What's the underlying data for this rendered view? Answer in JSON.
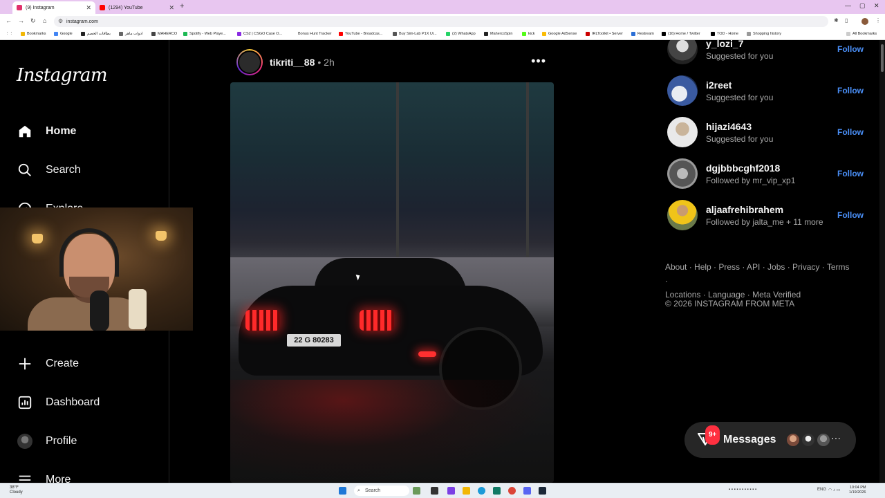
{
  "browser": {
    "tabs": [
      {
        "label": "(9) Instagram",
        "active": true,
        "favicon_color": "#e1306c"
      },
      {
        "label": "(1294) YouTube",
        "active": false,
        "favicon_color": "#ff0000"
      }
    ],
    "url": "instagram.com",
    "bookmarks": [
      "Bookmarks",
      "Google",
      "بطاقات الخصم",
      "ادوات ماهر",
      "MAHERCO",
      "Spotify - Web Playe...",
      "CS2 | CSGO Case O...",
      "Bonus Hunt Tracker",
      "YouTube - Broadcas...",
      "Buy Sim-Lab P1X Ui...",
      "(2) WhatsApp",
      "MahercoSpin",
      "kick",
      "Google AdSense",
      "IRLToolkit • Server",
      "Restream",
      "(16) Home / Twitter",
      "TOD - Home",
      "Shopping history",
      "All Bookmarks"
    ]
  },
  "sidebar": {
    "logo": "Instagram",
    "items": [
      {
        "label": "Home",
        "icon": "home-icon",
        "bold": true
      },
      {
        "label": "Search",
        "icon": "search-icon"
      },
      {
        "label": "Explore",
        "icon": "explore-icon"
      },
      {
        "label": "Create",
        "icon": "plus-icon"
      },
      {
        "label": "Dashboard",
        "icon": "dashboard-icon"
      },
      {
        "label": "Profile",
        "icon": "avatar"
      },
      {
        "label": "More",
        "icon": "menu-icon"
      }
    ]
  },
  "post": {
    "username": "tikriti__88",
    "time": "• 2h",
    "more_label": "•••",
    "plate_text": "22 G 80283"
  },
  "suggestions": [
    {
      "username": "y_lozi_7",
      "subtitle": "Suggested for you",
      "action": "Follow"
    },
    {
      "username": "i2reet",
      "subtitle": "Suggested for you",
      "action": "Follow"
    },
    {
      "username": "hijazi4643",
      "subtitle": "Suggested for you",
      "action": "Follow"
    },
    {
      "username": "dgjbbbcghf2018",
      "subtitle": "Followed by mr_vip_xp1",
      "action": "Follow"
    },
    {
      "username": "aljaafrehibrahem",
      "subtitle": "Followed by jalta_me + 11 more",
      "action": "Follow"
    }
  ],
  "footer": {
    "links_line1": "About · Help · Press · API · Jobs · Privacy · Terms ·",
    "links_line2": "Locations · Language · Meta Verified",
    "copyright": "© 2026 INSTAGRAM FROM META"
  },
  "messages": {
    "label": "Messages",
    "badge": "9+"
  },
  "taskbar": {
    "weather_temp": "38°F",
    "weather_desc": "Cloudy",
    "search_placeholder": "Search",
    "lang": "ENG",
    "time": "10:04 PM",
    "date": "1/19/2026"
  },
  "colors": {
    "accent": "#4a8ff7",
    "badge": "#ff3040"
  }
}
